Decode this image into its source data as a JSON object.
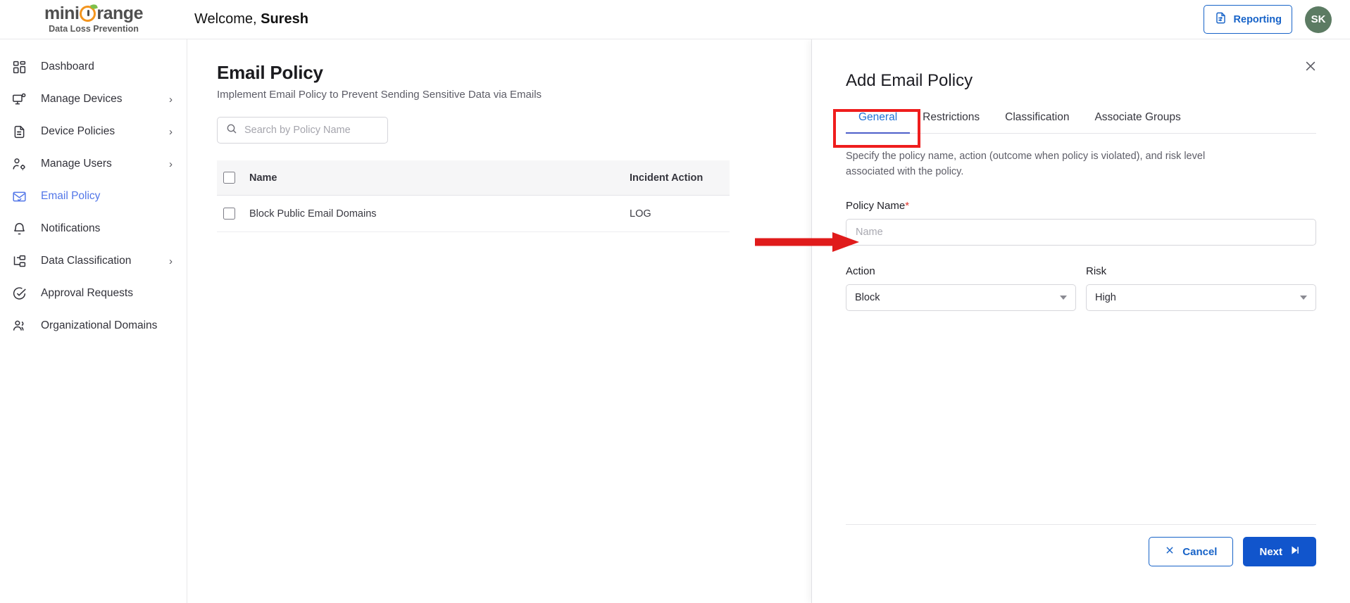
{
  "header": {
    "logo_main_pre": "mini",
    "logo_main_post": "range",
    "logo_sub": "Data Loss Prevention",
    "welcome_prefix": "Welcome,",
    "welcome_name": "Suresh",
    "reporting_label": "Reporting",
    "avatar_initials": "SK",
    "accent_blue": "#1763c8",
    "avatar_bg": "#5c7b63",
    "logo_orange": "#f3951e"
  },
  "sidebar": {
    "items": [
      {
        "label": "Dashboard",
        "icon": "dashboard-icon",
        "has_chevron": false,
        "active": false
      },
      {
        "label": "Manage Devices",
        "icon": "monitor-icon",
        "has_chevron": true,
        "active": false
      },
      {
        "label": "Device Policies",
        "icon": "document-settings-icon",
        "has_chevron": true,
        "active": false
      },
      {
        "label": "Manage Users",
        "icon": "user-gear-icon",
        "has_chevron": true,
        "active": false
      },
      {
        "label": "Email Policy",
        "icon": "mail-check-icon",
        "has_chevron": false,
        "active": true
      },
      {
        "label": "Notifications",
        "icon": "bell-icon",
        "has_chevron": false,
        "active": false
      },
      {
        "label": "Data Classification",
        "icon": "hierarchy-icon",
        "has_chevron": true,
        "active": false
      },
      {
        "label": "Approval Requests",
        "icon": "check-circle-icon",
        "has_chevron": false,
        "active": false
      },
      {
        "label": "Organizational Domains",
        "icon": "users-icon",
        "has_chevron": false,
        "active": false
      }
    ],
    "chevron_glyph": "›",
    "active_color": "#5276e8"
  },
  "main": {
    "title": "Email Policy",
    "subtitle": "Implement Email Policy to Prevent Sending Sensitive Data via Emails",
    "search": {
      "value": "",
      "placeholder": "Search by Policy Name",
      "icon": "search-icon"
    },
    "table": {
      "columns": [
        "Name",
        "Incident Action"
      ],
      "rows": [
        {
          "name": "Block Public Email Domains",
          "incident_action": "LOG",
          "selected": false
        }
      ],
      "select_all": false
    }
  },
  "drawer": {
    "title": "Add Email Policy",
    "close_icon": "close-icon",
    "tabs": [
      {
        "label": "General",
        "active": true
      },
      {
        "label": "Restrictions",
        "active": false
      },
      {
        "label": "Classification",
        "active": false
      },
      {
        "label": "Associate Groups",
        "active": false
      }
    ],
    "description": "Specify the policy name, action (outcome when policy is violated), and risk level associated with the policy.",
    "policy_name": {
      "label": "Policy Name",
      "required_marker": "*",
      "value": "",
      "placeholder": "Name"
    },
    "action": {
      "label": "Action",
      "value": "Block"
    },
    "risk": {
      "label": "Risk",
      "value": "High"
    },
    "footer": {
      "cancel_label": "Cancel",
      "cancel_icon": "close-icon",
      "next_label": "Next",
      "next_icon": "skip-forward-icon"
    },
    "active_tab_color": "#1f72d6"
  },
  "annotations": {
    "highlight_color": "#ef1d1d",
    "tab_highlight_target": "General",
    "arrow_target": "policy-name-input"
  }
}
